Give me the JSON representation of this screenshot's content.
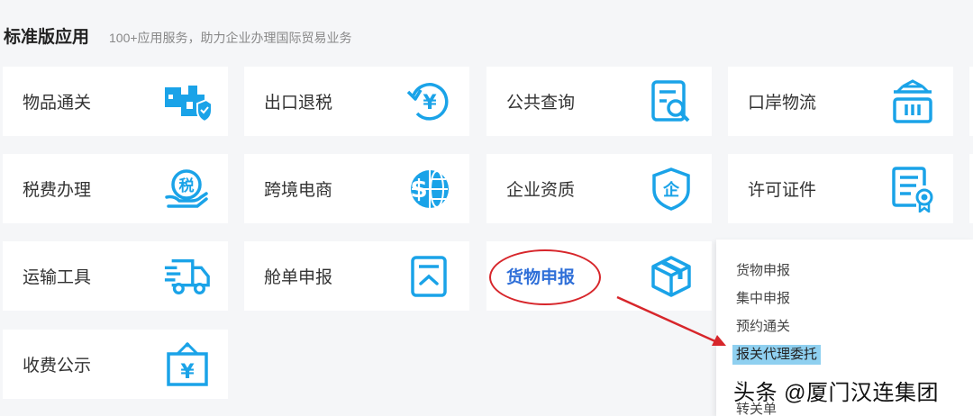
{
  "header": {
    "title": "标准版应用",
    "subtitle": "100+应用服务，助力企业办理国际贸易业务"
  },
  "tiles": [
    {
      "label": "物品通关",
      "icon": "goods-clearance-icon"
    },
    {
      "label": "出口退税",
      "icon": "yen-refund-icon"
    },
    {
      "label": "公共查询",
      "icon": "document-search-icon"
    },
    {
      "label": "口岸物流",
      "icon": "gantry-crane-icon"
    },
    {
      "label": "税费办理",
      "icon": "tax-hand-icon"
    },
    {
      "label": "跨境电商",
      "icon": "dollar-globe-icon"
    },
    {
      "label": "企业资质",
      "icon": "shield-enterprise-icon"
    },
    {
      "label": "许可证件",
      "icon": "certificate-icon"
    },
    {
      "label": "运输工具",
      "icon": "truck-icon"
    },
    {
      "label": "舱单申报",
      "icon": "manifest-icon"
    },
    {
      "label": "货物申报",
      "icon": "package-box-icon"
    },
    {
      "label": "收费公示",
      "icon": "fee-sign-icon"
    }
  ],
  "dropdown": {
    "items": [
      "货物申报",
      "集中申报",
      "预约通关",
      "报关代理委托",
      "...",
      "转关单"
    ],
    "highlighted_index": 3
  },
  "watermark": "头条 @厦门汉连集团",
  "colors": {
    "accent": "#1aa3e8",
    "active_label": "#2f6fd8",
    "annotation": "#d7262b",
    "highlight": "#8fd0f0"
  }
}
